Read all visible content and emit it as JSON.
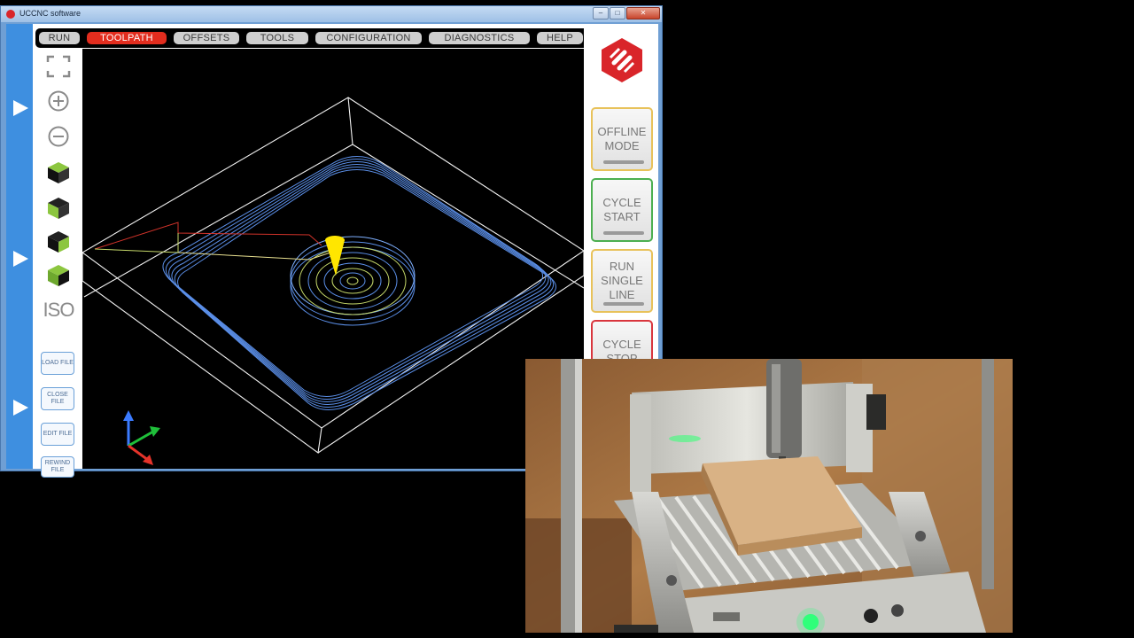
{
  "window": {
    "title": "UCCNC software",
    "controls": [
      "–",
      "□",
      "✕"
    ]
  },
  "menu": {
    "tabs": [
      "RUN",
      "TOOLPATH",
      "OFFSETS",
      "TOOLS",
      "CONFIGURATION",
      "DIAGNOSTICS",
      "HELP"
    ],
    "active": "TOOLPATH"
  },
  "toolbar": {
    "iso_label": "ISO",
    "load_file": "LOAD FILE",
    "close_file": "CLOSE FILE",
    "edit_file": "EDIT FILE",
    "rewind_file": "REWIND FILE",
    "icons": [
      "fullscreen-icon",
      "zoom-in-icon",
      "zoom-out-icon",
      "view-top-icon",
      "view-front-icon",
      "view-side-icon",
      "view-iso-icon"
    ]
  },
  "side_buttons": {
    "offline_mode": [
      "OFFLINE",
      "MODE"
    ],
    "cycle_start": [
      "CYCLE",
      "START"
    ],
    "run_single_line": [
      "RUN",
      "SINGLE",
      "LINE"
    ],
    "cycle_stop": [
      "CYCLE",
      "STOP"
    ]
  },
  "colors": {
    "active_tab": "#e22d1e",
    "strip_blue": "#3e8fe0",
    "offline_border": "#e8c25a",
    "start_border": "#4caf50",
    "single_border": "#e8c25a",
    "stop_border": "#d9363e",
    "toolpath_blue": "#5b8fe8",
    "tool_yellow": "#ffe600"
  }
}
